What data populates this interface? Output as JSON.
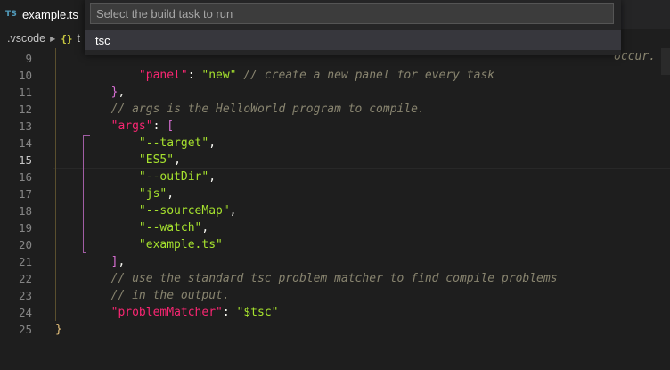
{
  "tabs": [
    {
      "badge": "TS",
      "title": "example.ts"
    }
  ],
  "breadcrumb": {
    "folder": ".vscode",
    "json_icon": "{}",
    "file_partial": "t"
  },
  "quick_pick": {
    "placeholder": "Select the build task to run",
    "value": "",
    "items": [
      {
        "label": "tsc"
      }
    ]
  },
  "overflow_text": "occur.",
  "editor": {
    "active_line": 15,
    "lines": [
      {
        "number": "9",
        "tokens": []
      },
      {
        "number": "10",
        "tokens": [
          {
            "t": "            ",
            "c": "p"
          },
          {
            "t": "\"panel\"",
            "c": "k"
          },
          {
            "t": ": ",
            "c": "p"
          },
          {
            "t": "\"new\"",
            "c": "s"
          },
          {
            "t": " ",
            "c": "p"
          },
          {
            "t": "// create a new panel for every task",
            "c": "c"
          }
        ]
      },
      {
        "number": "11",
        "tokens": [
          {
            "t": "        ",
            "c": "p"
          },
          {
            "t": "}",
            "c": "br-p"
          },
          {
            "t": ",",
            "c": "p"
          }
        ]
      },
      {
        "number": "12",
        "tokens": [
          {
            "t": "        ",
            "c": "p"
          },
          {
            "t": "// args is the HelloWorld program to compile.",
            "c": "c"
          }
        ]
      },
      {
        "number": "13",
        "tokens": [
          {
            "t": "        ",
            "c": "p"
          },
          {
            "t": "\"args\"",
            "c": "k"
          },
          {
            "t": ": ",
            "c": "p"
          },
          {
            "t": "[",
            "c": "br-p"
          }
        ]
      },
      {
        "number": "14",
        "tokens": [
          {
            "t": "            ",
            "c": "p"
          },
          {
            "t": "\"--target\"",
            "c": "s"
          },
          {
            "t": ",",
            "c": "p"
          }
        ]
      },
      {
        "number": "15",
        "tokens": [
          {
            "t": "            ",
            "c": "p"
          },
          {
            "t": "\"ES5\"",
            "c": "s"
          },
          {
            "t": ",",
            "c": "p"
          }
        ]
      },
      {
        "number": "16",
        "tokens": [
          {
            "t": "            ",
            "c": "p"
          },
          {
            "t": "\"--outDir\"",
            "c": "s"
          },
          {
            "t": ",",
            "c": "p"
          }
        ]
      },
      {
        "number": "17",
        "tokens": [
          {
            "t": "            ",
            "c": "p"
          },
          {
            "t": "\"js\"",
            "c": "s"
          },
          {
            "t": ",",
            "c": "p"
          }
        ]
      },
      {
        "number": "18",
        "tokens": [
          {
            "t": "            ",
            "c": "p"
          },
          {
            "t": "\"--sourceMap\"",
            "c": "s"
          },
          {
            "t": ",",
            "c": "p"
          }
        ]
      },
      {
        "number": "19",
        "tokens": [
          {
            "t": "            ",
            "c": "p"
          },
          {
            "t": "\"--watch\"",
            "c": "s"
          },
          {
            "t": ",",
            "c": "p"
          }
        ]
      },
      {
        "number": "20",
        "tokens": [
          {
            "t": "            ",
            "c": "p"
          },
          {
            "t": "\"example.ts\"",
            "c": "s"
          }
        ]
      },
      {
        "number": "21",
        "tokens": [
          {
            "t": "        ",
            "c": "p"
          },
          {
            "t": "]",
            "c": "br-p"
          },
          {
            "t": ",",
            "c": "p"
          }
        ]
      },
      {
        "number": "22",
        "tokens": [
          {
            "t": "        ",
            "c": "p"
          },
          {
            "t": "// use the standard tsc problem matcher to find compile problems",
            "c": "c"
          }
        ]
      },
      {
        "number": "23",
        "tokens": [
          {
            "t": "        ",
            "c": "p"
          },
          {
            "t": "// in the output.",
            "c": "c"
          }
        ]
      },
      {
        "number": "24",
        "tokens": [
          {
            "t": "        ",
            "c": "p"
          },
          {
            "t": "\"problemMatcher\"",
            "c": "k"
          },
          {
            "t": ": ",
            "c": "p"
          },
          {
            "t": "\"$tsc\"",
            "c": "s"
          }
        ]
      },
      {
        "number": "25",
        "tokens": [
          {
            "t": "",
            "c": "p"
          },
          {
            "t": "}",
            "c": "br-y"
          }
        ]
      }
    ]
  },
  "colors": {
    "editor_bg": "#1e1e1e",
    "keyword": "#f92672",
    "string": "#a6e22e",
    "comment": "#88846f",
    "bracket_yellow": "#e5c07b",
    "bracket_purple": "#da70d6",
    "bracket_blue": "#179fff",
    "ts_badge": "#519aba"
  }
}
